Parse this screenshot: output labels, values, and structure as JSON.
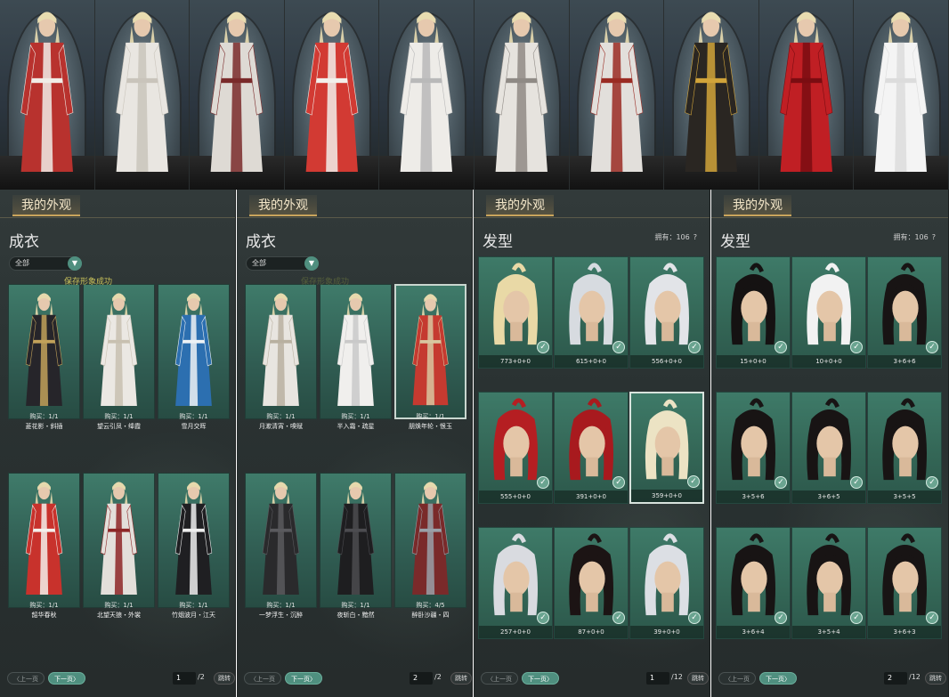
{
  "top_strip": {
    "figures": [
      {
        "outfit": "red-white robe",
        "robe_color": "#b8322e",
        "trim_color": "#f0ece6"
      },
      {
        "outfit": "white robe",
        "robe_color": "#e9e6e1",
        "trim_color": "#c9c4bb"
      },
      {
        "outfit": "white armored robe",
        "robe_color": "#dedad4",
        "trim_color": "#7a2a2a"
      },
      {
        "outfit": "red-white long robe",
        "robe_color": "#d23a33",
        "trim_color": "#f2efea"
      },
      {
        "outfit": "white flowing robe",
        "robe_color": "#eeece8",
        "trim_color": "#b9b9b9"
      },
      {
        "outfit": "white coat",
        "robe_color": "#e6e3de",
        "trim_color": "#8f8a85"
      },
      {
        "outfit": "white ornate robe",
        "robe_color": "#e2dfdb",
        "trim_color": "#9a2b23"
      },
      {
        "outfit": "gold black cloak",
        "robe_color": "#2a2622",
        "trim_color": "#d1a43a"
      },
      {
        "outfit": "red feather gown",
        "robe_color": "#c01f24",
        "trim_color": "#7a0d12"
      },
      {
        "outfit": "white fur gown",
        "robe_color": "#f4f4f4",
        "trim_color": "#dcdcdc"
      }
    ]
  },
  "panels": [
    {
      "tab_label": "我的外观",
      "section_title": "成衣",
      "filter_value": "全部",
      "toast": "保存形象成功",
      "toast_faded": false,
      "items": [
        {
          "purchase": "购买：1/1",
          "name": "菱花影・斜插",
          "robe_color": "#26252a",
          "trim_color": "#c2a25a",
          "selected": false
        },
        {
          "purchase": "购买：1/1",
          "name": "望云引凤・绛霞",
          "robe_color": "#ebe8e3",
          "trim_color": "#c8c0b0",
          "selected": false
        },
        {
          "purchase": "购买：1/1",
          "name": "雪月交晖",
          "robe_color": "#2c6fb0",
          "trim_color": "#eef2f5",
          "selected": false
        },
        {
          "purchase": "购买：1/1",
          "name": "韶华春秋",
          "robe_color": "#c8322c",
          "trim_color": "#f3f0eb",
          "selected": false
        },
        {
          "purchase": "购买：1/1",
          "name": "北望天狼・外裳",
          "robe_color": "#e3dfda",
          "trim_color": "#8d2626",
          "selected": false
        },
        {
          "purchase": "购买：1/1",
          "name": "竹烟波月・江天",
          "robe_color": "#1f1f22",
          "trim_color": "#eeeeee",
          "selected": false
        }
      ],
      "pager": {
        "prev": "上一页",
        "next": "下一页",
        "page": "1",
        "total": "/2",
        "jump": "跳转"
      }
    },
    {
      "tab_label": "我的外观",
      "section_title": "成衣",
      "filter_value": "全部",
      "toast": "保存形象成功",
      "toast_faded": true,
      "items": [
        {
          "purchase": "购买：1/1",
          "name": "月漱清宵・嗅赋",
          "robe_color": "#e8e5e0",
          "trim_color": "#b8b0a0",
          "selected": false
        },
        {
          "purchase": "购买：1/1",
          "name": "半入霜・疏星",
          "robe_color": "#f0efed",
          "trim_color": "#c9c9c9",
          "selected": false
        },
        {
          "purchase": "购买：1/1",
          "name": "朋焕年轮・恨玉",
          "robe_color": "#c53a30",
          "trim_color": "#d8c7a0",
          "selected": true
        },
        {
          "purchase": "购买：1/1",
          "name": "一梦浮生・沉醉",
          "robe_color": "#2a2a2c",
          "trim_color": "#5a5a5e",
          "selected": false
        },
        {
          "purchase": "购买：1/1",
          "name": "夜斩白・黯然",
          "robe_color": "#1e1e20",
          "trim_color": "#4c4c50",
          "selected": false
        },
        {
          "purchase": "购买：4/5",
          "name": "醉卧沙疆・四",
          "robe_color": "#7a2a2a",
          "trim_color": "#9aa0a8",
          "selected": false
        }
      ],
      "pager": {
        "prev": "上一页",
        "next": "下一页",
        "page": "2",
        "total": "/2",
        "jump": "跳转"
      }
    },
    {
      "tab_label": "我的外观",
      "section_title": "发型",
      "owned_label": "拥有：106",
      "help": "?",
      "items": [
        {
          "code": "773+0+0",
          "hair_color": "#e9d9a6",
          "selected": false
        },
        {
          "code": "615+0+0",
          "hair_color": "#d7dbe0",
          "selected": false
        },
        {
          "code": "556+0+0",
          "hair_color": "#e2e4e8",
          "selected": false
        },
        {
          "code": "555+0+0",
          "hair_color": "#b51e22",
          "selected": false
        },
        {
          "code": "391+0+0",
          "hair_color": "#a81a1e",
          "selected": false
        },
        {
          "code": "359+0+0",
          "hair_color": "#ece3c4",
          "selected": true
        },
        {
          "code": "257+0+0",
          "hair_color": "#d9dbe0",
          "selected": false
        },
        {
          "code": "87+0+0",
          "hair_color": "#1c1414",
          "selected": false
        },
        {
          "code": "39+0+0",
          "hair_color": "#dcdfe4",
          "selected": false
        }
      ],
      "pager": {
        "prev": "上一页",
        "next": "下一页",
        "page": "1",
        "total": "/12",
        "jump": "跳转"
      }
    },
    {
      "tab_label": "我的外观",
      "section_title": "发型",
      "owned_label": "拥有：106",
      "help": "?",
      "items": [
        {
          "code": "15+0+0",
          "hair_color": "#151212",
          "selected": false
        },
        {
          "code": "10+0+0",
          "hair_color": "#f2f2f2",
          "selected": false
        },
        {
          "code": "3+6+6",
          "hair_color": "#181414",
          "selected": false
        },
        {
          "code": "3+5+6",
          "hair_color": "#181414",
          "selected": false
        },
        {
          "code": "3+6+5",
          "hair_color": "#181414",
          "selected": false
        },
        {
          "code": "3+5+5",
          "hair_color": "#181414",
          "selected": false
        },
        {
          "code": "3+6+4",
          "hair_color": "#181414",
          "selected": false
        },
        {
          "code": "3+5+4",
          "hair_color": "#181414",
          "selected": false
        },
        {
          "code": "3+6+3",
          "hair_color": "#181414",
          "selected": false
        }
      ],
      "pager": {
        "prev": "上一页",
        "next": "下一页",
        "page": "2",
        "total": "/12",
        "jump": "跳转"
      }
    }
  ]
}
